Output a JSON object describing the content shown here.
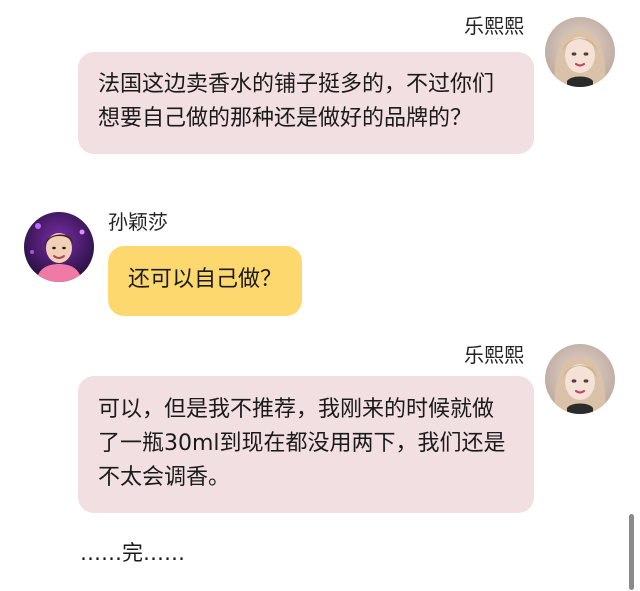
{
  "messages": [
    {
      "sender": "乐熙熙",
      "side": "right",
      "text": "法国这边卖香水的铺子挺多的，不过你们想要自己做的那种还是做好的品牌的？"
    },
    {
      "sender": "孙颖莎",
      "side": "left",
      "text": "还可以自己做？"
    },
    {
      "sender": "乐熙熙",
      "side": "right",
      "text": "可以，但是我不推荐，我刚来的时候就做了一瓶30ml到现在都没用两下，我们还是不太会调香。"
    }
  ],
  "ending_text": "……完……",
  "colors": {
    "right_bubble": "#f1dfe2",
    "left_bubble": "#fdd86f",
    "background": "#ffffff"
  },
  "icons": {
    "right_avatar": "avatar-female-photo-icon",
    "left_avatar": "avatar-male-photo-icon"
  }
}
